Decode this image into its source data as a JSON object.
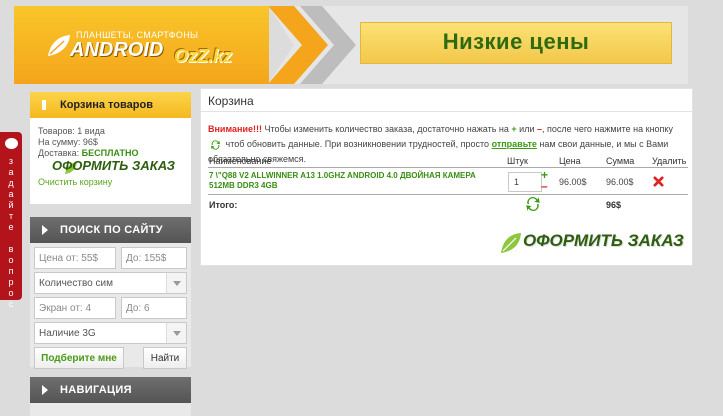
{
  "header": {
    "logo_tagline": "ПЛАНШЕТЫ, СМАРТФОНЫ",
    "logo_main": "ANDROID",
    "logo_brand": "OzZ.kz",
    "banner_text": "Низкие цены"
  },
  "sidebar": {
    "cart": {
      "title": "Корзина товаров",
      "items_line": "Товаров: 1 вида",
      "sum_line": "На сумму: 96$",
      "delivery_label": "Доставка:",
      "delivery_value": "БЕСПЛАТНО",
      "order_button": "ОФОРМИТЬ ЗАКАЗ",
      "clear_link": "Очистить корзину"
    },
    "search": {
      "title": "ПОИСК ПО САЙТУ",
      "price_from_placeholder": "Цена от: 55$",
      "price_to_placeholder": "До: 155$",
      "sim_select": "Количество сим",
      "screen_from_placeholder": "Экран от: 4",
      "screen_to_placeholder": "До: 6",
      "g3_select": "Наличие 3G",
      "suggest_button": "Подберите мне",
      "find_button": "Найти"
    },
    "nav": {
      "title": "НАВИГАЦИЯ"
    }
  },
  "side_tab": {
    "label_lines": [
      "з",
      "а",
      "д",
      "а",
      "й",
      "т",
      "е",
      "",
      "в",
      "о",
      "п",
      "р",
      "о",
      "с"
    ]
  },
  "main": {
    "title": "Корзина",
    "notice": {
      "warning": "Внимание!!!",
      "part1": " Чтобы изменить количество заказа, достаточно нажать на ",
      "plus": "+",
      "part2": " или ",
      "minus": "–",
      "part3": ", после чего нажмите на кнопку ",
      "part4": " чтоб обновить данные. При возникновении трудностей, просто ",
      "send_link": "отправьте",
      "part5": " нам свои данные, и мы с Вами обязательно свяжемся."
    },
    "table": {
      "headers": {
        "name": "Наименование",
        "qty": "Штук",
        "price": "Цена",
        "sum": "Сумма",
        "delete": "Удалить"
      },
      "rows": [
        {
          "name": "7 \\\"Q88 V2 ALLWINNER A13 1.0GHZ ANDROID 4.0 ДВОЙНАЯ КАМЕРА 512MB DDR3 4GB",
          "qty": "1",
          "price": "96.00$",
          "sum": "96.00$"
        }
      ],
      "total_label": "Итого:",
      "total_value": "96$"
    },
    "order_button": "ОФОРМИТЬ ЗАКАЗ"
  },
  "colors": {
    "accent_yellow": "#f5b81f",
    "green": "#3b8d14",
    "red": "#d22222",
    "dark_header": "#5f5f5f"
  }
}
